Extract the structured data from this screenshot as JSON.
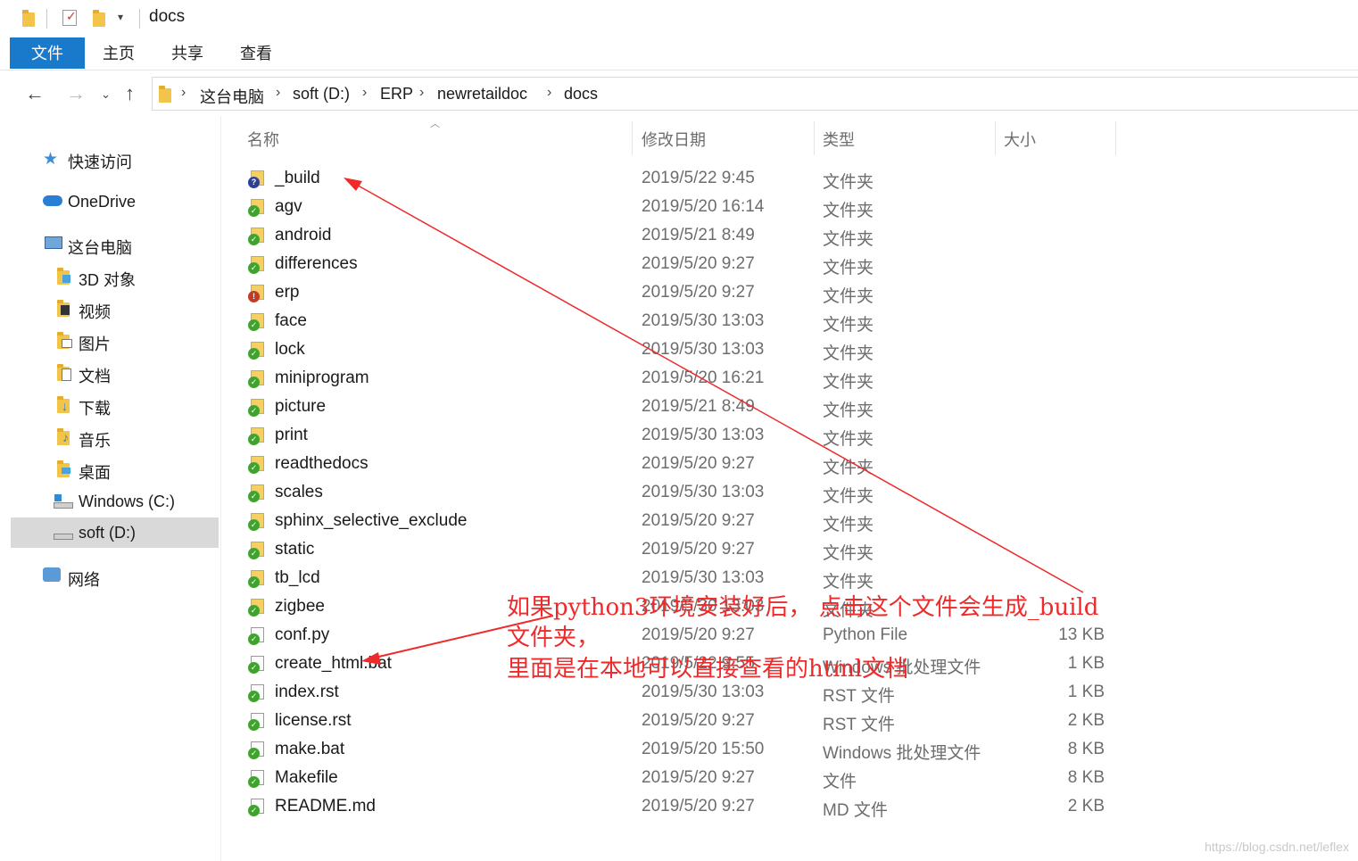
{
  "window": {
    "title": "docs"
  },
  "ribbon": {
    "tabs": [
      "文件",
      "主页",
      "共享",
      "查看"
    ]
  },
  "address": {
    "crumbs": [
      "这台电脑",
      "soft (D:)",
      "ERP",
      "newretaildoc",
      "docs"
    ]
  },
  "nav": {
    "quick_access": "快速访问",
    "onedrive": "OneDrive",
    "this_pc": "这台电脑",
    "items": [
      "3D 对象",
      "视频",
      "图片",
      "文档",
      "下载",
      "音乐",
      "桌面",
      "Windows (C:)",
      "soft (D:)"
    ],
    "network": "网络"
  },
  "columns": {
    "name": "名称",
    "date": "修改日期",
    "type": "类型",
    "size": "大小"
  },
  "files": [
    {
      "name": "_build",
      "date": "2019/5/22 9:45",
      "type": "文件夹",
      "size": "",
      "kind": "folder",
      "status": "question"
    },
    {
      "name": "agv",
      "date": "2019/5/20 16:14",
      "type": "文件夹",
      "size": "",
      "kind": "folder",
      "status": "ok"
    },
    {
      "name": "android",
      "date": "2019/5/21 8:49",
      "type": "文件夹",
      "size": "",
      "kind": "folder",
      "status": "ok"
    },
    {
      "name": "differences",
      "date": "2019/5/20 9:27",
      "type": "文件夹",
      "size": "",
      "kind": "folder",
      "status": "ok"
    },
    {
      "name": "erp",
      "date": "2019/5/20 9:27",
      "type": "文件夹",
      "size": "",
      "kind": "folder",
      "status": "error"
    },
    {
      "name": "face",
      "date": "2019/5/30 13:03",
      "type": "文件夹",
      "size": "",
      "kind": "folder",
      "status": "ok"
    },
    {
      "name": "lock",
      "date": "2019/5/30 13:03",
      "type": "文件夹",
      "size": "",
      "kind": "folder",
      "status": "ok"
    },
    {
      "name": "miniprogram",
      "date": "2019/5/20 16:21",
      "type": "文件夹",
      "size": "",
      "kind": "folder",
      "status": "ok"
    },
    {
      "name": "picture",
      "date": "2019/5/21 8:49",
      "type": "文件夹",
      "size": "",
      "kind": "folder",
      "status": "ok"
    },
    {
      "name": "print",
      "date": "2019/5/30 13:03",
      "type": "文件夹",
      "size": "",
      "kind": "folder",
      "status": "ok"
    },
    {
      "name": "readthedocs",
      "date": "2019/5/20 9:27",
      "type": "文件夹",
      "size": "",
      "kind": "folder",
      "status": "ok"
    },
    {
      "name": "scales",
      "date": "2019/5/30 13:03",
      "type": "文件夹",
      "size": "",
      "kind": "folder",
      "status": "ok"
    },
    {
      "name": "sphinx_selective_exclude",
      "date": "2019/5/20 9:27",
      "type": "文件夹",
      "size": "",
      "kind": "folder",
      "status": "ok"
    },
    {
      "name": "static",
      "date": "2019/5/20 9:27",
      "type": "文件夹",
      "size": "",
      "kind": "folder",
      "status": "ok"
    },
    {
      "name": "tb_lcd",
      "date": "2019/5/30 13:03",
      "type": "文件夹",
      "size": "",
      "kind": "folder",
      "status": "ok"
    },
    {
      "name": "zigbee",
      "date": "2019/5/30 13:03",
      "type": "文件夹",
      "size": "",
      "kind": "folder",
      "status": "ok"
    },
    {
      "name": "conf.py",
      "date": "2019/5/20 9:27",
      "type": "Python File",
      "size": "13 KB",
      "kind": "file",
      "status": "ok"
    },
    {
      "name": "create_html.bat",
      "date": "2019/5/22 9:55",
      "type": "Windows 批处理文件",
      "size": "1 KB",
      "kind": "file",
      "status": "ok"
    },
    {
      "name": "index.rst",
      "date": "2019/5/30 13:03",
      "type": "RST 文件",
      "size": "1 KB",
      "kind": "file",
      "status": "ok"
    },
    {
      "name": "license.rst",
      "date": "2019/5/20 9:27",
      "type": "RST 文件",
      "size": "2 KB",
      "kind": "file",
      "status": "ok"
    },
    {
      "name": "make.bat",
      "date": "2019/5/20 15:50",
      "type": "Windows 批处理文件",
      "size": "8 KB",
      "kind": "file",
      "status": "ok"
    },
    {
      "name": "Makefile",
      "date": "2019/5/20 9:27",
      "type": "文件",
      "size": "8 KB",
      "kind": "file",
      "status": "ok"
    },
    {
      "name": "README.md",
      "date": "2019/5/20 9:27",
      "type": "MD 文件",
      "size": "2 KB",
      "kind": "file",
      "status": "ok"
    }
  ],
  "annotation": {
    "lines": [
      "如果python3环境安装好后， 点击这个文件会生成_build",
      "文件夹，",
      "里面是在本地可以直接查看的html文档"
    ],
    "color": "#ee2a2a"
  },
  "watermark": "https://blog.csdn.net/leflex",
  "colors": {
    "accent": "#1979ca",
    "selected": "#d9d9d9"
  }
}
